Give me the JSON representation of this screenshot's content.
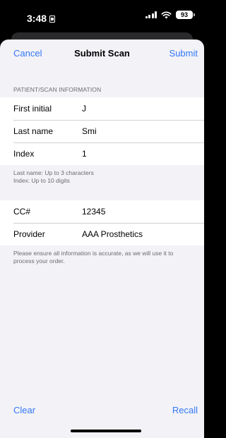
{
  "status_bar": {
    "time": "3:48",
    "battery": "93"
  },
  "nav": {
    "cancel_label": "Cancel",
    "title": "Submit Scan",
    "submit_label": "Submit"
  },
  "section": {
    "header": "PATIENT/SCAN INFORMATION"
  },
  "fields": {
    "first_initial": {
      "label": "First initial",
      "value": "J"
    },
    "last_name": {
      "label": "Last name",
      "value": "Smi"
    },
    "index": {
      "label": "Index",
      "value": "1"
    }
  },
  "hints": {
    "line1": "Last name: Up to 3 characters",
    "line2": "Index: Up to 10 digits"
  },
  "fields2": {
    "cc": {
      "label": "CC#",
      "value": "12345"
    },
    "provider": {
      "label": "Provider",
      "value": "AAA Prosthetics"
    }
  },
  "notice": "Please ensure all information is accurate, as we will use it to process your order.",
  "bottom": {
    "clear_label": "Clear",
    "recall_label": "Recall"
  },
  "colors": {
    "accent": "#3478f6",
    "background": "#f2f2f7"
  }
}
